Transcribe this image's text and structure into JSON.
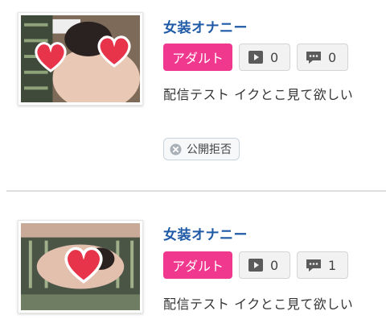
{
  "items": [
    {
      "title": "女装オナニー",
      "category": "アダルト",
      "views": "0",
      "comments": "0",
      "description": "配信テスト イクとこ見て欲しい",
      "status": "公開拒否",
      "thumbnail_icon": "heart-icon"
    },
    {
      "title": "女装オナニー",
      "category": "アダルト",
      "views": "0",
      "comments": "1",
      "description": "配信テスト イクとこ見て欲しい",
      "thumbnail_icon": "heart-icon"
    }
  ],
  "colors": {
    "title": "#1f5aa6",
    "category_badge": "#f1388f",
    "heart": "#e8344a"
  }
}
